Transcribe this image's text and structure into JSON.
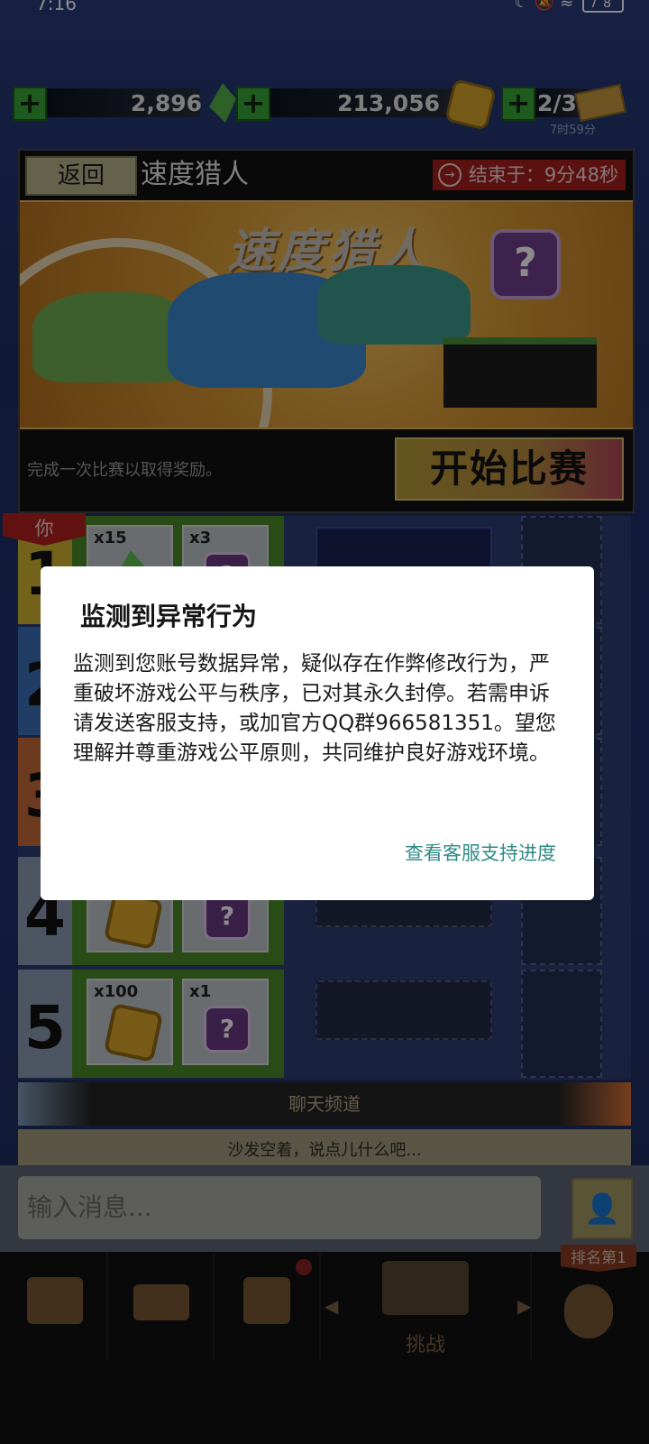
{
  "status_bar": {
    "time": "7:16",
    "battery": "78"
  },
  "currency": {
    "gems": "2,896",
    "coins": "213,056",
    "tickets": "2/3",
    "ticket_timer": "7时59分"
  },
  "event": {
    "back_label": "返回",
    "title": "速度猎人",
    "end_timer": "结束于：9分48秒",
    "banner_title": "速度猎人",
    "description": "完成一次比赛以取得奖励。",
    "start_button": "开始比赛"
  },
  "leaderboard": {
    "you_label": "你",
    "rows": [
      {
        "rank": "1",
        "reward1_qty": "x15",
        "reward2_qty": "x3"
      },
      {
        "rank": "2",
        "reward1_qty": "",
        "reward2_qty": ""
      },
      {
        "rank": "3",
        "reward1_qty": "",
        "reward2_qty": ""
      },
      {
        "rank": "4",
        "reward1_qty": "",
        "reward2_qty": ""
      },
      {
        "rank": "5",
        "reward1_qty": "x100",
        "reward2_qty": "x1"
      }
    ]
  },
  "chat": {
    "header": "聊天频道",
    "hint": "沙发空着，说点儿什么吧...",
    "input_placeholder": "输入消息..."
  },
  "nav": {
    "challenge_label": "挑战",
    "rank_badge": "排名第1"
  },
  "dialog": {
    "title": "监测到异常行为",
    "body": "监测到您账号数据异常，疑似存在作弊修改行为，严重破坏游戏公平与秩序，已对其永久封停。若需申诉请发送客服支持，或加官方QQ群966581351。望您理解并尊重游戏公平原则，共同维护良好游戏环境。",
    "link": "查看客服支持进度"
  }
}
